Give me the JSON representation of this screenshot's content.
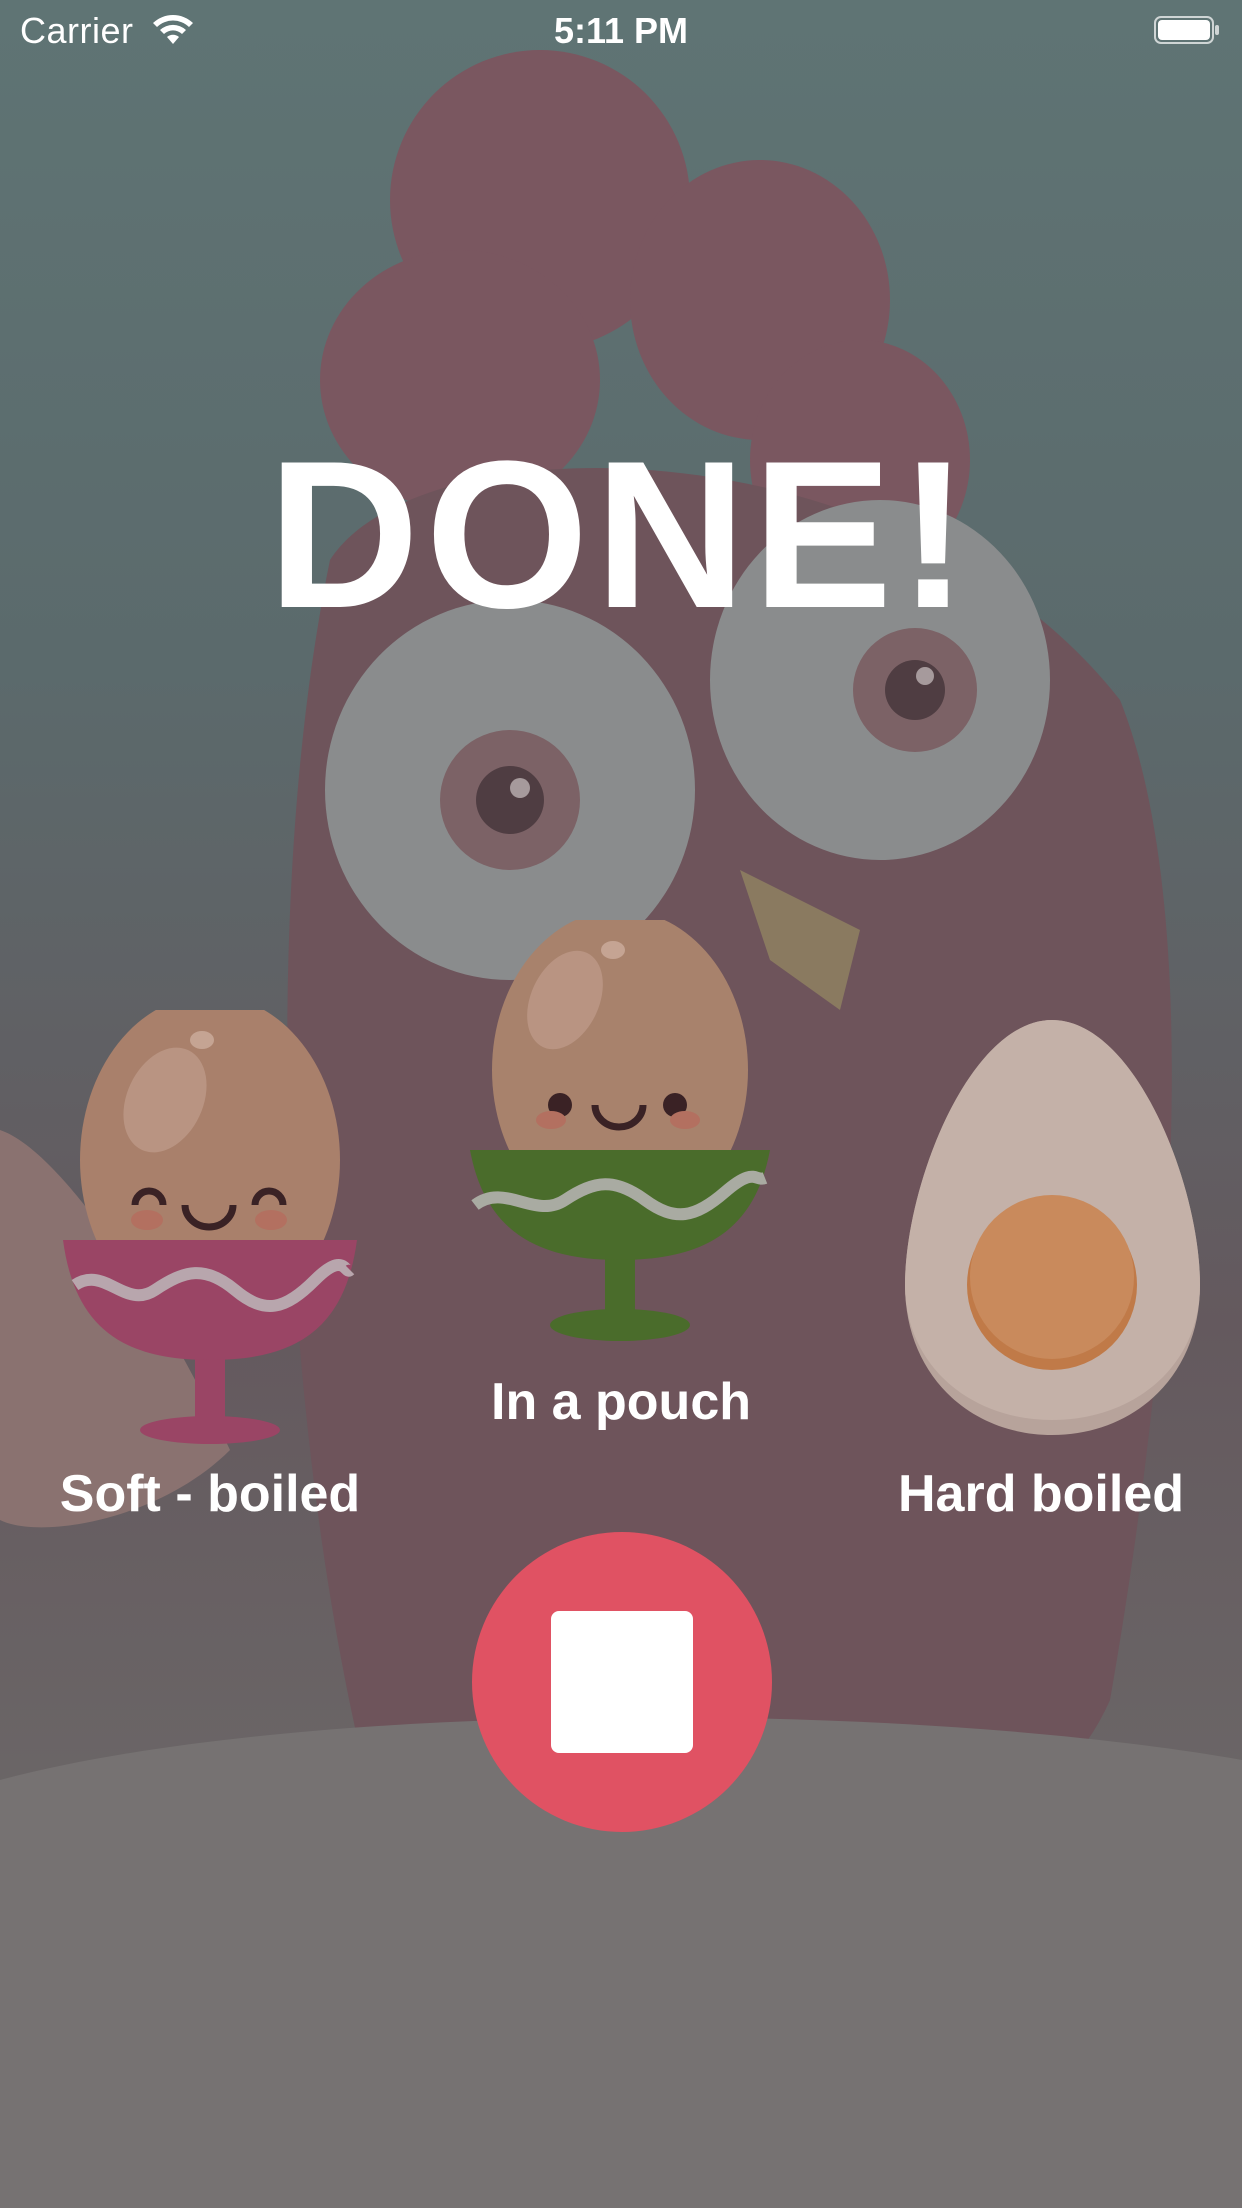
{
  "status_bar": {
    "carrier": "Carrier",
    "time": "5:11 PM"
  },
  "main": {
    "title": "DONE!",
    "eggs": [
      {
        "label": "Soft - boiled",
        "icon": "soft-boiled-egg-icon"
      },
      {
        "label": "In a pouch",
        "icon": "pouch-egg-icon"
      },
      {
        "label": "Hard boiled",
        "icon": "hard-boiled-egg-icon"
      }
    ],
    "stop_icon": "stop-icon"
  },
  "colors": {
    "accent": "#e05263",
    "text": "#ffffff"
  }
}
